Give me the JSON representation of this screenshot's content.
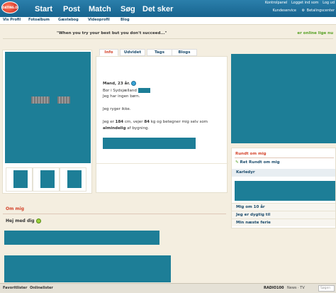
{
  "logo": {
    "text": "DATING.DK"
  },
  "nav": {
    "items": [
      "Start",
      "Post",
      "Match",
      "Søg",
      "Det sker"
    ]
  },
  "util": {
    "top": [
      "Kontrolpanel",
      "Logget ind som",
      "Log ud"
    ],
    "bottom": [
      "Kundeservice",
      "Betalingscenter"
    ]
  },
  "subnav": {
    "items": [
      "Vis Profil",
      "Fotoalbum",
      "Gæstebog",
      "Videoprofil",
      "Blog"
    ]
  },
  "quote": "\"When you try your best but you don't succeed...\"",
  "online": "er online lige nu",
  "tabs": [
    "Info",
    "Udvidet",
    "Tags",
    "Blogs"
  ],
  "info": {
    "line1": "Mand, 23 år.",
    "line2": "Bor i Sydsjælland",
    "line3": "Jeg har ingen børn.",
    "line4": "Jeg ryger ikke.",
    "line5a": "Jeg er",
    "height": "184",
    "line5b": "cm, vejer",
    "weight": "84",
    "line5c": "kg og betegner mig selv som",
    "build": "almindelig",
    "line6": "af bygning."
  },
  "rundt": {
    "title": "Rundt om mig",
    "edit": "Ret Rundt om mig",
    "karle": "Karledyr",
    "q1": "Mig om 10 år",
    "q2": "Jeg er dygtig til",
    "q3": "Min næste ferie"
  },
  "ommig": {
    "title": "Om mig",
    "greeting": "Hej med dig"
  },
  "bottom": {
    "left": [
      "Favoritlister",
      "Onlinelister"
    ],
    "radio": "RADIO100",
    "news": "News · TV",
    "search": "Søgen"
  },
  "colors": {
    "accent": "#d4432a",
    "link": "#1a4a6b",
    "censor": "#1d7e97",
    "online": "#55a022"
  }
}
